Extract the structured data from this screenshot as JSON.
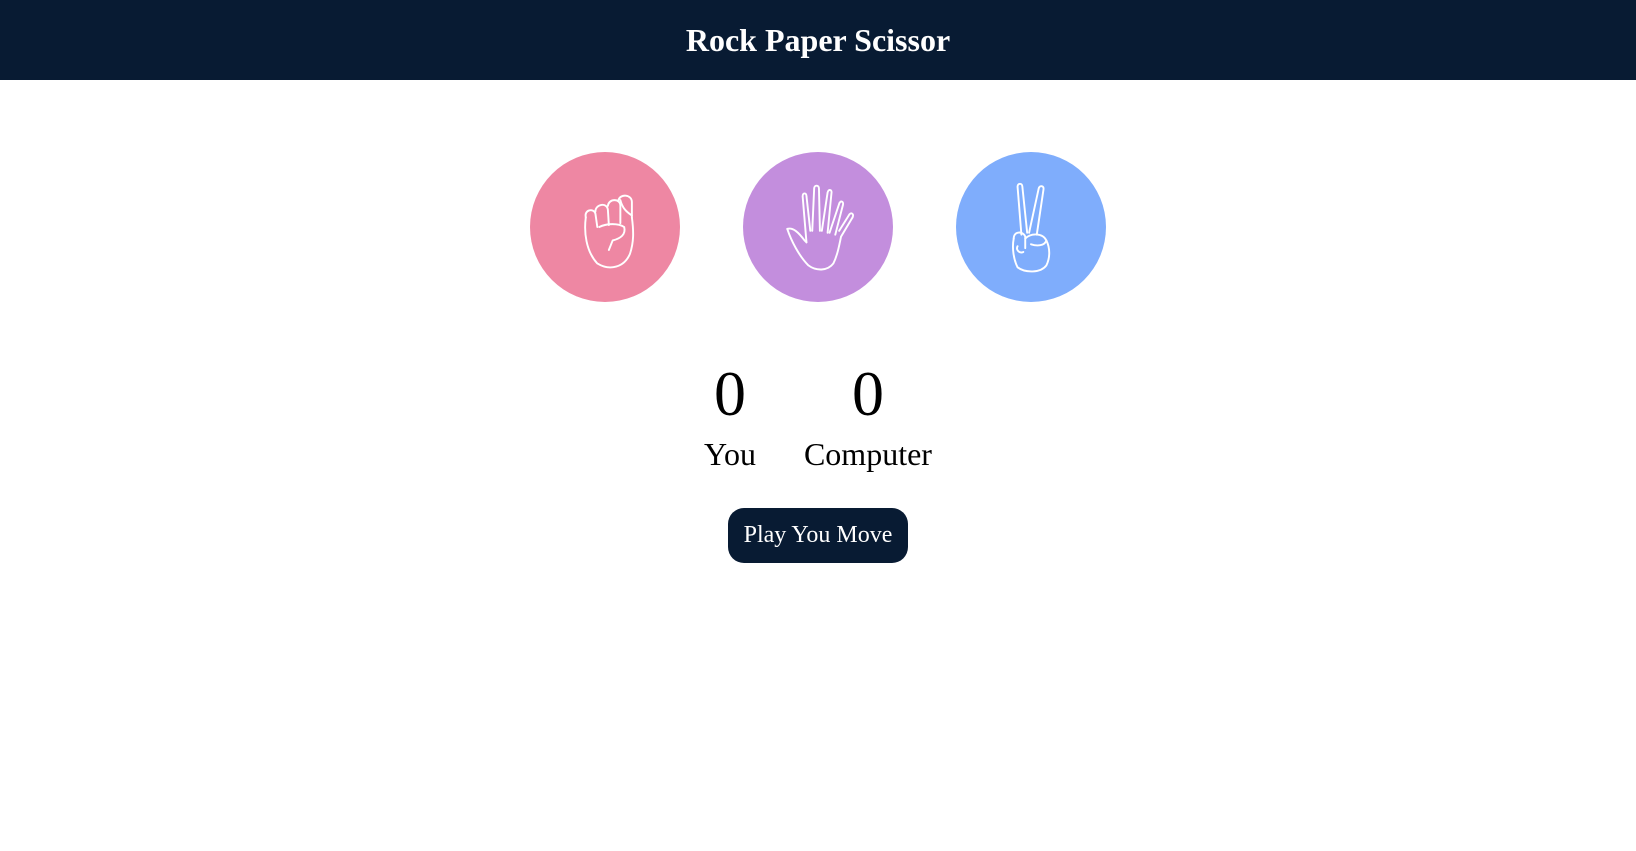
{
  "header": {
    "title": "Rock Paper Scissor"
  },
  "choices": [
    {
      "id": "rock",
      "icon": "fist-icon",
      "color": "#ee87a3"
    },
    {
      "id": "paper",
      "icon": "open-hand-icon",
      "color": "#c38edd"
    },
    {
      "id": "scissors",
      "icon": "peace-hand-icon",
      "color": "#7fadfc"
    }
  ],
  "scoreboard": {
    "user_score": "0",
    "user_label": "You",
    "computer_score": "0",
    "computer_label": "Computer"
  },
  "message": {
    "text": "Play You Move"
  },
  "colors": {
    "header_bg": "#081b33",
    "message_bg": "#081b33"
  }
}
